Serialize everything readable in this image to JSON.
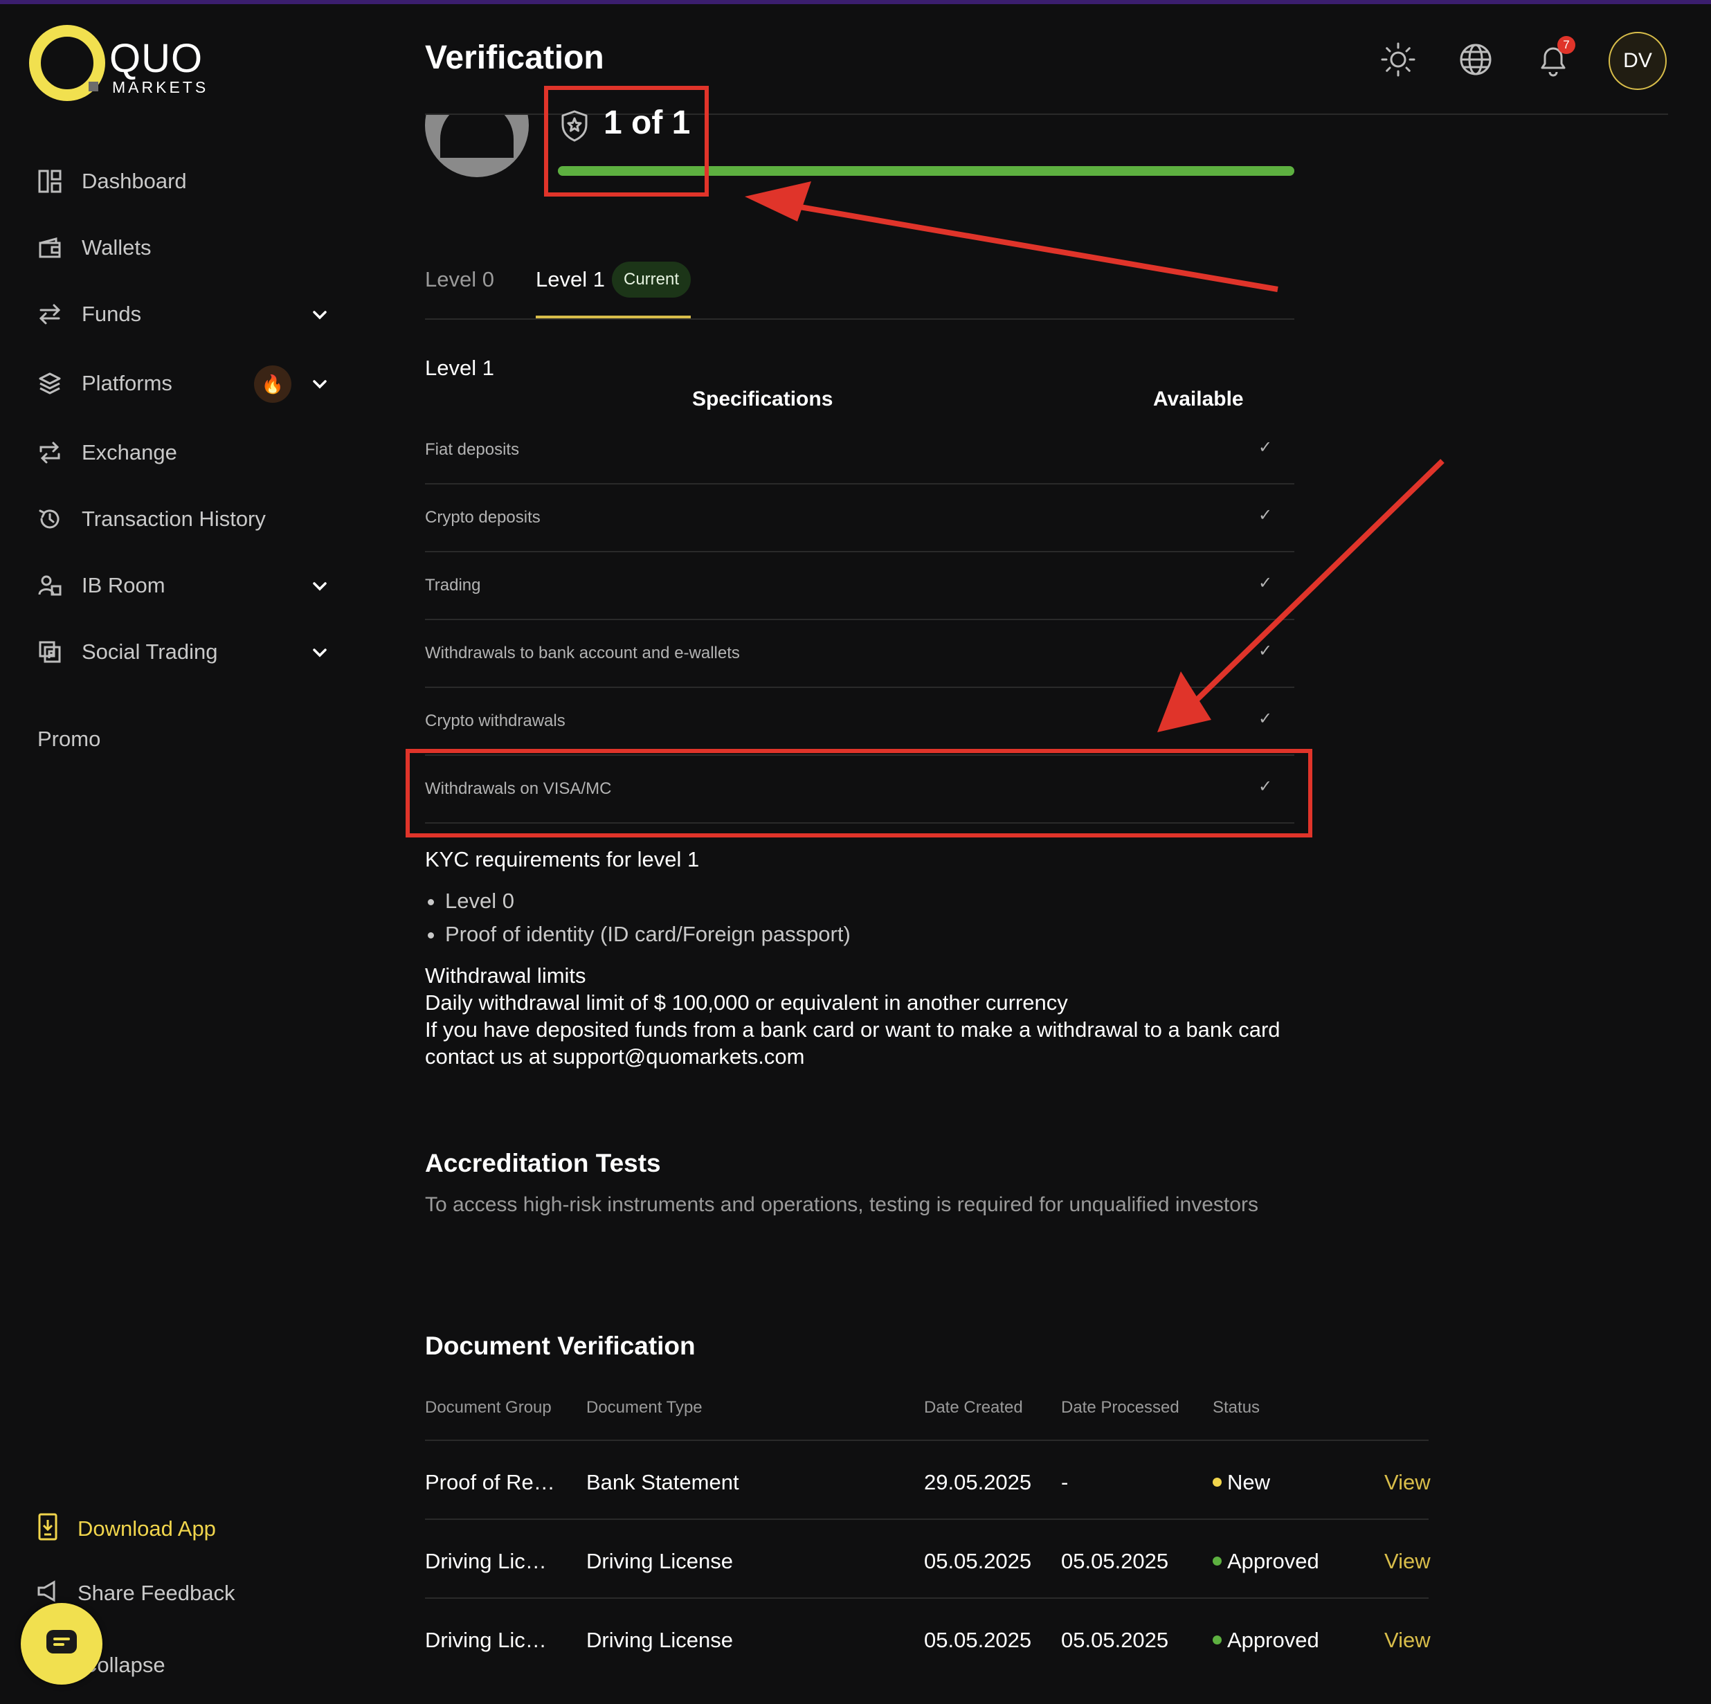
{
  "colors": {
    "background": "#0f0f10",
    "accent_yellow": "#f1e04f",
    "link_gold": "#d8bd4a",
    "progress_green": "#5db040",
    "status_new": "#f1d54c",
    "status_approved": "#5db040",
    "annotation_red": "#e0342a"
  },
  "logo": {
    "name": "QUO",
    "sub": "MARKETS"
  },
  "sidebar": {
    "items": [
      {
        "label": "Dashboard",
        "icon": "dashboard-icon",
        "expandable": false
      },
      {
        "label": "Wallets",
        "icon": "wallet-icon",
        "expandable": false
      },
      {
        "label": "Funds",
        "icon": "transfer-arrows-icon",
        "expandable": true
      },
      {
        "label": "Platforms",
        "icon": "layers-icon",
        "expandable": true,
        "badge_icon": "fire-icon"
      },
      {
        "label": "Exchange",
        "icon": "exchange-icon",
        "expandable": false
      },
      {
        "label": "Transaction History",
        "icon": "history-icon",
        "expandable": false
      },
      {
        "label": "IB Room",
        "icon": "users-icon",
        "expandable": true
      },
      {
        "label": "Social Trading",
        "icon": "copy-trading-icon",
        "expandable": true
      }
    ],
    "promo": "Promo",
    "download_app": "Download App",
    "share_feedback": "Share Feedback",
    "collapse": "Collapse"
  },
  "header": {
    "title": "Verification",
    "notifications_count": "7",
    "avatar_initials": "DV",
    "icons": [
      "theme-sun-icon",
      "globe-icon",
      "bell-icon"
    ]
  },
  "progress": {
    "label": "1 of 1",
    "fraction": 1.0
  },
  "tabs": [
    {
      "label": "Level 0",
      "active": false
    },
    {
      "label": "Level 1",
      "active": true,
      "badge": "Current"
    }
  ],
  "level_section": {
    "title": "Level 1",
    "spec_header": "Specifications",
    "available_header": "Available",
    "rows": [
      {
        "label": "Fiat deposits",
        "available": "✓"
      },
      {
        "label": "Crypto deposits",
        "available": "✓"
      },
      {
        "label": "Trading",
        "available": "✓"
      },
      {
        "label": "Withdrawals to bank account and e-wallets",
        "available": "✓"
      },
      {
        "label": "Crypto withdrawals",
        "available": "✓"
      },
      {
        "label": "Withdrawals on VISA/MC",
        "available": "✓"
      }
    ]
  },
  "kyc": {
    "title": "KYC requirements for level 1",
    "items": [
      "Level 0",
      "Proof of identity (ID card/Foreign passport)"
    ]
  },
  "withdrawal": {
    "title": "Withdrawal limits",
    "line1": "Daily withdrawal limit of $ 100,000 or equivalent in another currency",
    "line2": "If you have deposited funds from a bank card or want to make a withdrawal to a bank card",
    "line3": "contact us at support@quomarkets.com"
  },
  "accreditation": {
    "title": "Accreditation Tests",
    "description": "To access high-risk instruments and operations, testing is required for unqualified investors"
  },
  "documents": {
    "title": "Document Verification",
    "columns": [
      "Document Group",
      "Document Type",
      "Date Created",
      "Date Processed",
      "Status"
    ],
    "rows": [
      {
        "group": "Proof of Re…",
        "type": "Bank Statement",
        "created": "29.05.2025",
        "processed": "-",
        "status": "New",
        "status_color": "#f1d54c",
        "action": "View"
      },
      {
        "group": "Driving Lic…",
        "type": "Driving License",
        "created": "05.05.2025",
        "processed": "05.05.2025",
        "status": "Approved",
        "status_color": "#5db040",
        "action": "View"
      },
      {
        "group": "Driving Lic…",
        "type": "Driving License",
        "created": "05.05.2025",
        "processed": "05.05.2025",
        "status": "Approved",
        "status_color": "#5db040",
        "action": "View"
      }
    ]
  }
}
